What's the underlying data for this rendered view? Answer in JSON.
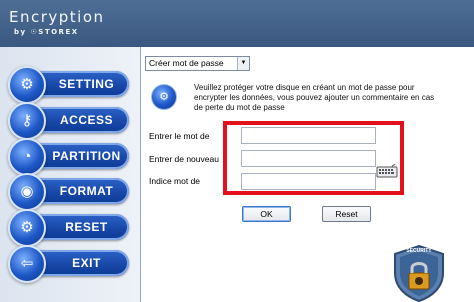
{
  "app": {
    "logo_main": "Encryption",
    "logo_sub": "by ☉STOREX"
  },
  "sidebar": {
    "items": [
      {
        "label": "SETTING",
        "icon": "gear-icon"
      },
      {
        "label": "ACCESS",
        "icon": "key-icon"
      },
      {
        "label": "PARTITION",
        "icon": "partition-icon"
      },
      {
        "label": "FORMAT",
        "icon": "disc-icon"
      },
      {
        "label": "RESET",
        "icon": "reset-gear-icon"
      },
      {
        "label": "EXIT",
        "icon": "exit-door-icon"
      }
    ]
  },
  "main": {
    "dropdown_value": "Créer mot de passe",
    "info_text": "Veuillez protéger votre disque en créant un mot de passe pour encrypter les données, vous pouvez ajouter un commentaire en cas de perte du mot de passe",
    "fields": [
      {
        "label": "Entrer le mot de",
        "value": ""
      },
      {
        "label": "Entrer de nouveau",
        "value": ""
      },
      {
        "label": "Indice mot de",
        "value": ""
      }
    ],
    "ok_label": "OK",
    "reset_label": "Reset",
    "badge_text": "SECURITY"
  },
  "colors": {
    "header": "#3a587f",
    "nav_button": "#1746a6",
    "highlight": "#e2111b"
  }
}
